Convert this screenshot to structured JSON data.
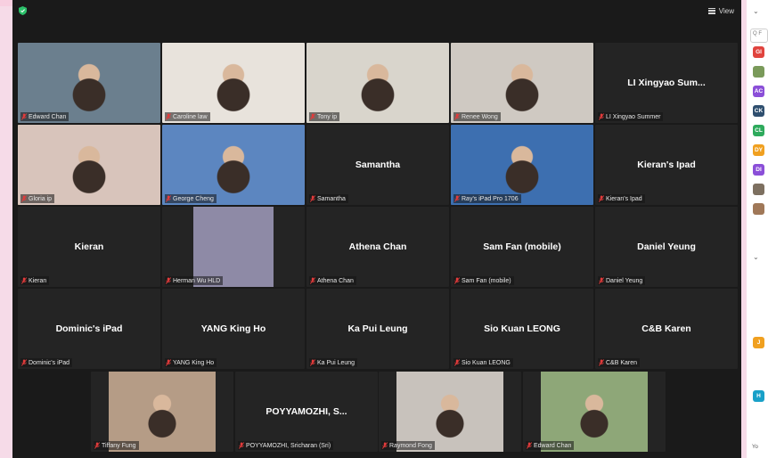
{
  "toolbar": {
    "view_label": "View"
  },
  "participants": [
    {
      "name": "Edward Chan",
      "display": "",
      "video": "#6b7f8e",
      "active": false
    },
    {
      "name": "Caroline law",
      "display": "",
      "video": "#e8e3dc",
      "active": false
    },
    {
      "name": "Tony ip",
      "display": "",
      "video": "#d9d5cc",
      "active": false
    },
    {
      "name": "Renee Wong",
      "display": "",
      "video": "#cfc9c2",
      "active": false
    },
    {
      "name": "LI Xingyao Summer",
      "display": "LI Xingyao Sum...",
      "video": "",
      "active": false
    },
    {
      "name": "Gloria ip",
      "display": "",
      "video": "#d8c4bb",
      "active": true
    },
    {
      "name": "George Cheng",
      "display": "",
      "video": "#5c86c0",
      "active": false
    },
    {
      "name": "Samantha",
      "display": "Samantha",
      "video": "",
      "active": false
    },
    {
      "name": "Ray's iPad Pro 1706",
      "display": "",
      "video": "#3d6fb0",
      "active": false
    },
    {
      "name": "Kieran's Ipad",
      "display": "Kieran's Ipad",
      "video": "",
      "active": false
    },
    {
      "name": "Kieran",
      "display": "Kieran",
      "video": "",
      "active": false
    },
    {
      "name": "Herman Wu HLD",
      "display": "",
      "video": "#8e8aa6",
      "active": false
    },
    {
      "name": "Athena Chan",
      "display": "Athena Chan",
      "video": "",
      "active": false
    },
    {
      "name": "Sam Fan (mobile)",
      "display": "Sam Fan (mobile)",
      "video": "",
      "active": false
    },
    {
      "name": "Daniel Yeung",
      "display": "Daniel Yeung",
      "video": "",
      "active": false
    },
    {
      "name": "Dominic's iPad",
      "display": "Dominic's iPad",
      "video": "",
      "active": false
    },
    {
      "name": "YANG King Ho",
      "display": "YANG King Ho",
      "video": "",
      "active": false
    },
    {
      "name": "Ka Pui Leung",
      "display": "Ka Pui Leung",
      "video": "",
      "active": false
    },
    {
      "name": "Sio Kuan LEONG",
      "display": "Sio Kuan LEONG",
      "video": "",
      "active": false
    },
    {
      "name": "C&B Karen",
      "display": "C&B Karen",
      "video": "",
      "active": false
    },
    {
      "name": "Tiffany Fung",
      "display": "",
      "video": "#b59c86",
      "active": false
    },
    {
      "name": "POYYAMOZHI, Sricharan (Sri)",
      "display": "POYYAMOZHI, S...",
      "video": "",
      "active": false
    },
    {
      "name": "Raymond Fong",
      "display": "",
      "video": "#c8c2bc",
      "active": false
    },
    {
      "name": "Edward Chan",
      "display": "",
      "video": "#8ea778",
      "active": false
    }
  ],
  "sidebar": {
    "search_placeholder": "Q F",
    "avatars": [
      {
        "initials": "GI",
        "color": "#e0443e"
      },
      {
        "initials": "",
        "color": "#7a9a5a"
      },
      {
        "initials": "AC",
        "color": "#8b4fd8"
      },
      {
        "initials": "CK",
        "color": "#2f4f6f"
      },
      {
        "initials": "CL",
        "color": "#2eaa5c"
      },
      {
        "initials": "DY",
        "color": "#f0a020"
      },
      {
        "initials": "DI",
        "color": "#8b4fd8"
      },
      {
        "initials": "",
        "color": "#7d7060"
      },
      {
        "initials": "",
        "color": "#a07858"
      },
      {
        "initials": "J",
        "color": "#f0a020"
      },
      {
        "initials": "H",
        "color": "#19a0c8"
      }
    ],
    "footer": "Yo"
  }
}
